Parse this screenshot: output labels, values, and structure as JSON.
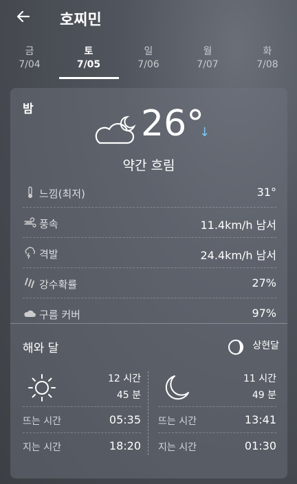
{
  "header": {
    "title": "호찌민",
    "back_icon": "arrow-left-icon"
  },
  "tabs": [
    {
      "day": "금",
      "date": "7/04"
    },
    {
      "day": "토",
      "date": "7/05"
    },
    {
      "day": "일",
      "date": "7/06"
    },
    {
      "day": "월",
      "date": "7/07"
    },
    {
      "day": "화",
      "date": "7/08"
    }
  ],
  "active_tab": "토",
  "night": {
    "label": "밤",
    "icon": "cloudy-night-icon",
    "temp": "26°",
    "trend": "↓",
    "condition": "약간 흐림",
    "details": [
      {
        "icon": "thermometer-icon",
        "label": "느낌(최저)",
        "value": "31°"
      },
      {
        "icon": "wind-icon",
        "label": "풍속",
        "value": "11.4km/h 남서"
      },
      {
        "icon": "gust-icon",
        "label": "격발",
        "value": "24.4km/h 남서"
      },
      {
        "icon": "rain-icon",
        "label": "강수확률",
        "value": "27%"
      },
      {
        "icon": "cloud-icon",
        "label": "구름 커버",
        "value": "97%"
      }
    ]
  },
  "sun_moon": {
    "title": "해와 달",
    "phase": "상현달",
    "sun": {
      "duration_h": "12 시간",
      "duration_m": "45 분",
      "rise_label": "뜨는 시간",
      "rise": "05:35",
      "set_label": "지는 시간",
      "set": "18:20"
    },
    "moon": {
      "duration_h": "11 시간",
      "duration_m": "49 분",
      "rise_label": "뜨는 시간",
      "rise": "13:41",
      "set_label": "지는 시간",
      "set": "01:30"
    }
  },
  "colors": {
    "accent_arrow": "#7ec6f0"
  }
}
